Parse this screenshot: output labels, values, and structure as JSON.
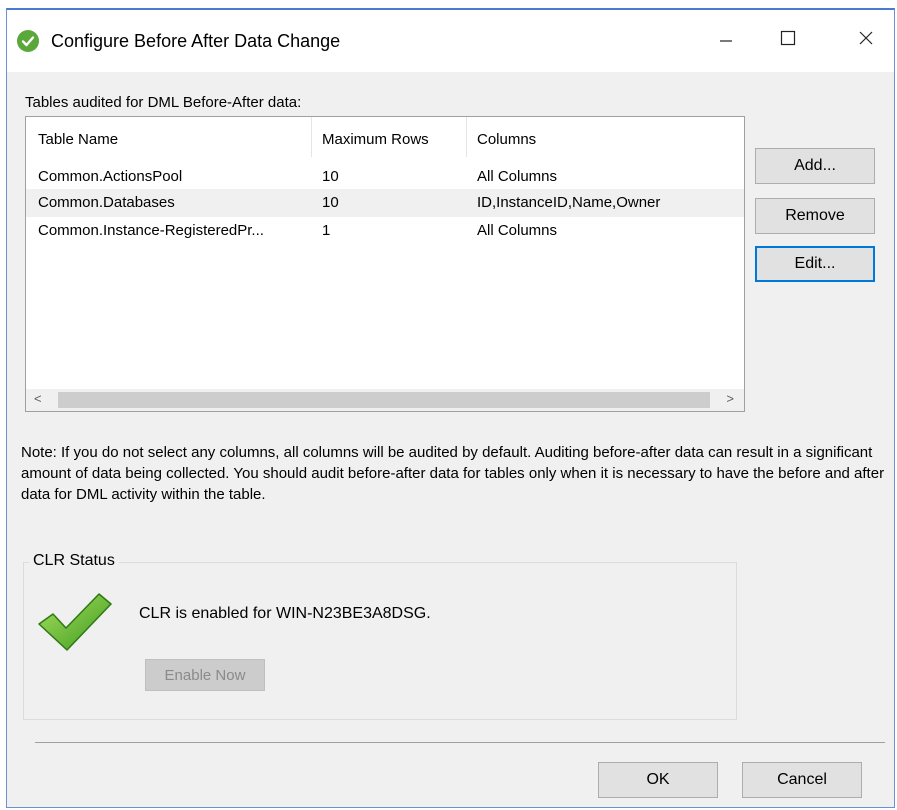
{
  "window": {
    "title": "Configure Before After Data Change",
    "app_icon": "check-circle-icon",
    "accent_color": "#5aa83a",
    "controls": {
      "minimize_icon": "minimize-icon",
      "maximize_icon": "maximize-icon",
      "close_icon": "close-icon"
    }
  },
  "tables_section": {
    "label": "Tables audited for DML Before-After data:",
    "columns": [
      "Table Name",
      "Maximum Rows",
      "Columns"
    ],
    "rows": [
      {
        "table": "Common.ActionsPool",
        "max_rows": "10",
        "columns": "All Columns",
        "selected": false
      },
      {
        "table": "Common.Databases",
        "max_rows": "10",
        "columns": "ID,InstanceID,Name,Owner",
        "selected": true
      },
      {
        "table": "Common.Instance-RegisteredPr...",
        "max_rows": "1",
        "columns": "All Columns",
        "selected": false
      }
    ],
    "scroll_left": "<",
    "scroll_right": ">"
  },
  "buttons": {
    "add": "Add...",
    "remove": "Remove",
    "edit": "Edit...",
    "ok": "OK",
    "cancel": "Cancel"
  },
  "note": "Note: If you do not select any columns, all columns will be audited by default. Auditing before-after data can result in a significant amount of data being collected. You should audit before-after data for tables only when it is necessary to have the before and after data for DML activity within the table.",
  "clr_status": {
    "group_title": "CLR Status",
    "icon": "big-checkmark-icon",
    "message": "CLR is enabled for WIN-N23BE3A8DSG.",
    "enable_button": "Enable Now",
    "enable_button_disabled": true
  }
}
